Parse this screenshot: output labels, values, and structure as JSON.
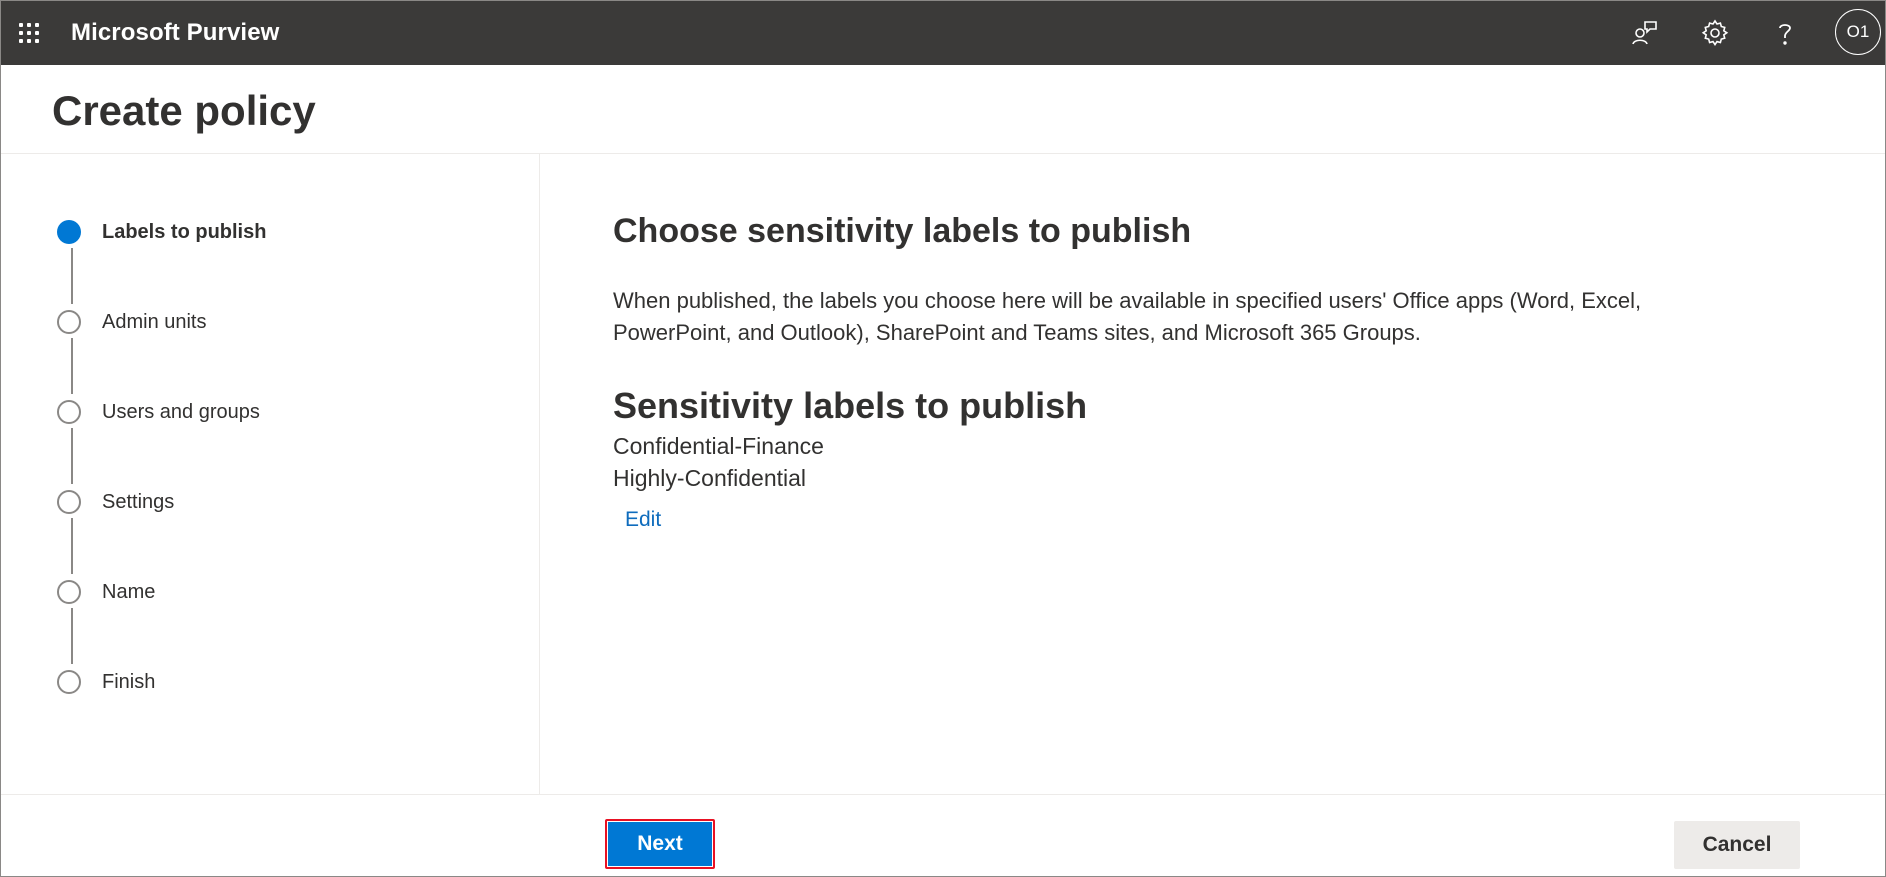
{
  "topbar": {
    "app_title": "Microsoft Purview",
    "icons": [
      "app-launcher-icon",
      "community-icon",
      "settings-gear-icon",
      "help-icon"
    ],
    "avatar_initials": "O1",
    "background": "#3b3a39"
  },
  "header": {
    "title": "Create policy"
  },
  "wizard": {
    "steps": [
      {
        "label": "Labels to publish",
        "state": "current"
      },
      {
        "label": "Admin units",
        "state": "pending"
      },
      {
        "label": "Users and groups",
        "state": "pending"
      },
      {
        "label": "Settings",
        "state": "pending"
      },
      {
        "label": "Name",
        "state": "pending"
      },
      {
        "label": "Finish",
        "state": "pending"
      }
    ],
    "accent_color": "#0078d4"
  },
  "main": {
    "heading": "Choose sensitivity labels to publish",
    "description": "When published, the labels you choose here will be available in specified users' Office apps (Word, Excel, PowerPoint, and Outlook), SharePoint and Teams sites, and Microsoft 365 Groups.",
    "labels_heading": "Sensitivity labels to publish",
    "labels": [
      "Confidential-Finance",
      "Highly-Confidential"
    ],
    "edit_link": "Edit"
  },
  "footer": {
    "next_label": "Next",
    "cancel_label": "Cancel",
    "highlight_color": "#e81123"
  }
}
